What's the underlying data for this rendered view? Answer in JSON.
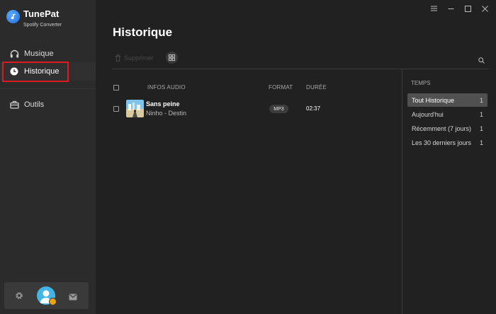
{
  "app": {
    "name": "TunePat",
    "subtitle": "Spotify Converter"
  },
  "sidebar": {
    "items": [
      {
        "label": "Musique",
        "icon": "headphones-icon"
      },
      {
        "label": "Historique",
        "icon": "clock-icon",
        "active": true
      },
      {
        "label": "Outils",
        "icon": "toolbox-icon"
      }
    ]
  },
  "page": {
    "title": "Historique",
    "delete_label": "Supprimer"
  },
  "table": {
    "headers": {
      "info": "INFOS AUDIO",
      "format": "FORMAT",
      "duration": "DURÉE"
    },
    "rows": [
      {
        "title": "Sans peine",
        "artist": "Ninho - Destin",
        "format": "MP3",
        "duration": "02:37"
      }
    ]
  },
  "filter": {
    "heading": "TEMPS",
    "items": [
      {
        "label": "Tout Historique",
        "count": "1",
        "active": true
      },
      {
        "label": "Aujourd'hui",
        "count": "1"
      },
      {
        "label": "Récemment (7 jours)",
        "count": "1"
      },
      {
        "label": "Les 30 derniers jours",
        "count": "1"
      }
    ]
  },
  "colors": {
    "accent": "#1e6fe0",
    "highlight": "#d91c22",
    "background": "#212121",
    "sidebar": "#2b2b2b"
  }
}
